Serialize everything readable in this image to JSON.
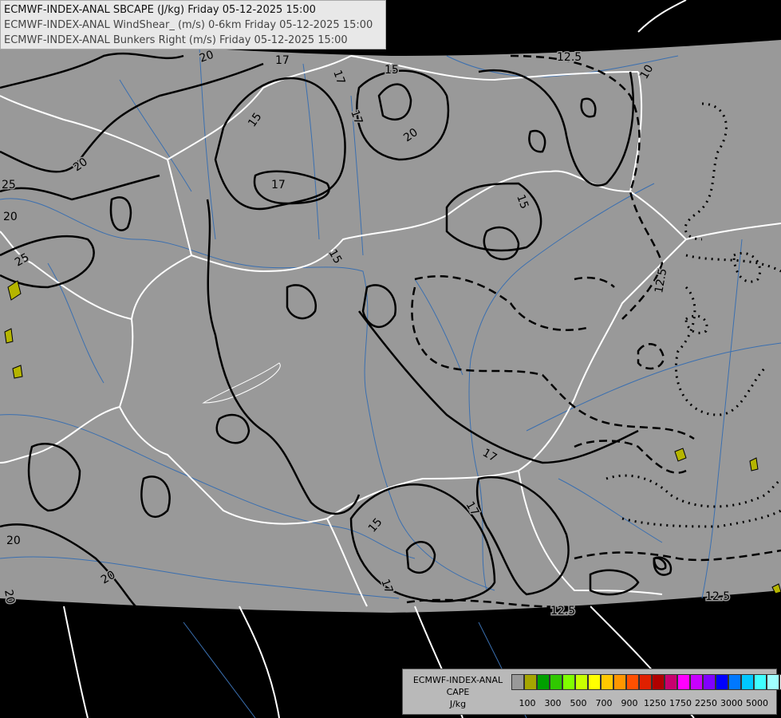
{
  "header": {
    "line1": "ECMWF-INDEX-ANAL SBCAPE (J/kg) Friday 05-12-2025 15:00",
    "line2": "ECMWF-INDEX-ANAL WindShear_ (m/s) 0-6km Friday 05-12-2025 15:00",
    "line3": "ECMWF-INDEX-ANAL Bunkers Right (m/s) Friday 05-12-2025 15:00"
  },
  "colors": {
    "background": "#000000",
    "field": "#999999",
    "borders": "#ffffff",
    "rivers": "#3a6fb0",
    "contours": "#000000",
    "cape_fill": "#b5b500"
  },
  "contour_labels": [
    {
      "text": "20"
    },
    {
      "text": "17"
    },
    {
      "text": "17"
    },
    {
      "text": "15"
    },
    {
      "text": "20"
    },
    {
      "text": "25"
    },
    {
      "text": "20"
    },
    {
      "text": "25"
    },
    {
      "text": "15"
    },
    {
      "text": "20"
    },
    {
      "text": "17"
    },
    {
      "text": "15"
    },
    {
      "text": "17"
    },
    {
      "text": "12.5"
    },
    {
      "text": "10"
    },
    {
      "text": "12.5"
    },
    {
      "text": "15"
    },
    {
      "text": "17"
    },
    {
      "text": "15"
    },
    {
      "text": "17"
    },
    {
      "text": "12.5"
    },
    {
      "text": "12.5"
    },
    {
      "text": "20"
    },
    {
      "text": "20"
    },
    {
      "text": "20"
    },
    {
      "text": "17"
    }
  ],
  "legend": {
    "model": "ECMWF-INDEX-ANAL",
    "field": "CAPE",
    "unit": "J/kg",
    "colors": [
      "#999999",
      "#a5a500",
      "#00a000",
      "#30c800",
      "#80ff00",
      "#c8ff00",
      "#ffff00",
      "#ffc800",
      "#ff9600",
      "#ff5000",
      "#e02000",
      "#b00000",
      "#c8006e",
      "#ff00ff",
      "#c800ff",
      "#8000ff",
      "#0000ff",
      "#0078ff",
      "#00c8ff",
      "#40ffff",
      "#a0ffff",
      "#ffffff"
    ],
    "ticks": [
      "100",
      "300",
      "500",
      "700",
      "900",
      "1250",
      "1750",
      "2250",
      "3000",
      "5000"
    ]
  }
}
